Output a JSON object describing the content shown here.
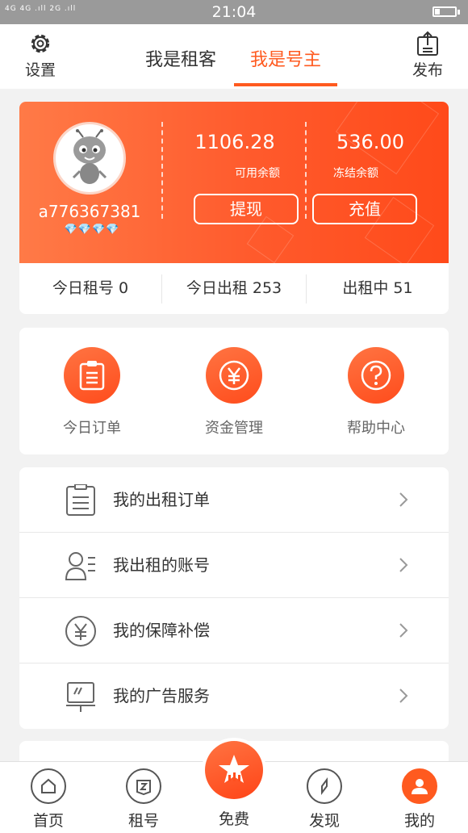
{
  "status_bar": {
    "network": "4G 4G .ıll 2G .ıll",
    "time": "21:04"
  },
  "header": {
    "settings_label": "设置",
    "publish_label": "发布",
    "tabs": [
      {
        "label": "我是租客",
        "active": false
      },
      {
        "label": "我是号主",
        "active": true
      }
    ]
  },
  "profile": {
    "username": "a776367381",
    "gems": "💎💎💎💎",
    "available_balance": "1106.28",
    "available_label": "可用余额",
    "frozen_balance": "536.00",
    "frozen_label": "冻结余额",
    "withdraw_label": "提现",
    "recharge_label": "充值"
  },
  "stats": [
    {
      "label": "今日租号 0"
    },
    {
      "label": "今日出租 253"
    },
    {
      "label": "出租中 51"
    }
  ],
  "quick_actions": [
    {
      "label": "今日订单",
      "icon": "clipboard-icon"
    },
    {
      "label": "资金管理",
      "icon": "yen-icon"
    },
    {
      "label": "帮助中心",
      "icon": "question-icon"
    }
  ],
  "menu": [
    {
      "label": "我的出租订单",
      "icon": "order-list-icon"
    },
    {
      "label": "我出租的账号",
      "icon": "account-icon"
    },
    {
      "label": "我的保障补偿",
      "icon": "yen-circle-icon"
    },
    {
      "label": "我的广告服务",
      "icon": "billboard-icon"
    }
  ],
  "bottom_nav": [
    {
      "label": "首页",
      "icon": "home-icon",
      "active": false
    },
    {
      "label": "租号",
      "icon": "rent-icon",
      "active": false
    },
    {
      "label": "免费",
      "icon": "star-icon",
      "active": false
    },
    {
      "label": "发现",
      "icon": "compass-icon",
      "active": false
    },
    {
      "label": "我的",
      "icon": "profile-icon",
      "active": true
    }
  ],
  "colors": {
    "accent": "#ff5a1f",
    "hero_start": "#ff7a47",
    "hero_end": "#ff4a1a"
  }
}
